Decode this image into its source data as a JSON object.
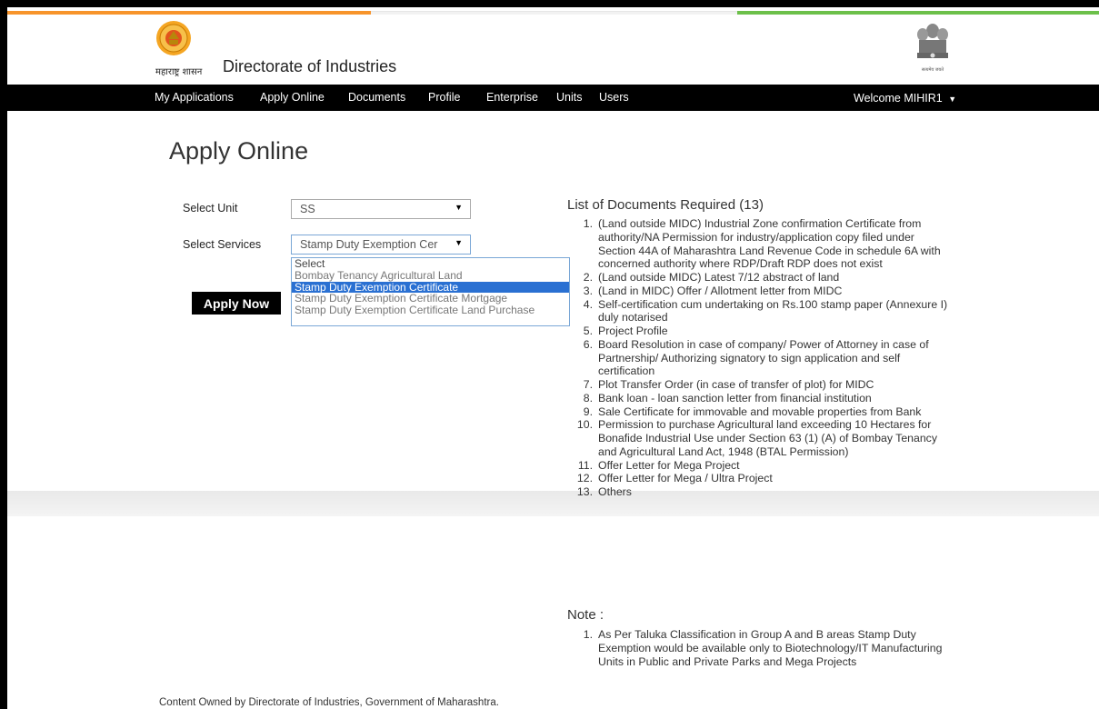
{
  "header": {
    "state_label": "महाराष्ट्र शासन",
    "site_title": "Directorate of Industries",
    "emblem_caption": "सत्यमेव जयते"
  },
  "nav": {
    "items": [
      "My Applications",
      "Apply Online",
      "Documents",
      "Profile",
      "Enterprise",
      "Units",
      "Users"
    ],
    "welcome": "Welcome MIHIR1"
  },
  "main": {
    "heading": "Apply Online",
    "unit_label": "Select Unit",
    "unit_value": "SS",
    "services_label": "Select Services",
    "services_value": "Stamp Duty Exemption Cer",
    "services_options": [
      "Select",
      "Bombay Tenancy Agricultural Land",
      "Stamp Duty Exemption Certificate",
      "Stamp Duty Exemption Certificate Mortgage",
      "Stamp Duty Exemption Certificate Land Purchase"
    ],
    "selected_option": "Stamp Duty Exemption Certificate",
    "apply_button": "Apply Now"
  },
  "documents": {
    "heading": "List of Documents Required (13)",
    "items": [
      "(Land outside MIDC) Industrial Zone confirmation Certificate from authority/NA Permission for industry/application copy filed under Section 44A of Maharashtra Land Revenue Code in schedule 6A with concerned authority where RDP/Draft RDP does not exist",
      "(Land outside MIDC) Latest 7/12 abstract of land",
      "(Land in MIDC) Offer / Allotment letter from MIDC",
      "Self-certification cum undertaking on Rs.100 stamp paper (Annexure I) duly notarised",
      "Project Profile",
      "Board Resolution in case of company/ Power of Attorney in case of Partnership/ Authorizing signatory to sign application and self certification",
      "Plot Transfer Order (in case of transfer of plot) for MIDC",
      "Bank loan - loan sanction letter from financial institution",
      "Sale Certificate for immovable and movable properties from Bank",
      "Permission to purchase Agricultural land exceeding 10 Hectares for Bonafide Industrial Use under Section 63 (1) (A) of Bombay Tenancy and Agricultural Land Act, 1948 (BTAL Permission)",
      "Offer Letter for Mega Project",
      "Offer Letter for Mega / Ultra Project",
      "Others"
    ]
  },
  "note": {
    "heading": "Note :",
    "items": [
      "As Per Taluka Classification in Group A and B areas Stamp Duty Exemption would be available only to Biotechnology/IT Manufacturing Units in Public and Private Parks and Mega Projects"
    ]
  },
  "footer": {
    "text": "Content Owned by Directorate of Industries, Government of Maharashtra."
  },
  "colors": {
    "saffron": "#f7942b",
    "green": "#6cc04a",
    "navbar": "#000000",
    "selected_option": "#2a70d2"
  }
}
